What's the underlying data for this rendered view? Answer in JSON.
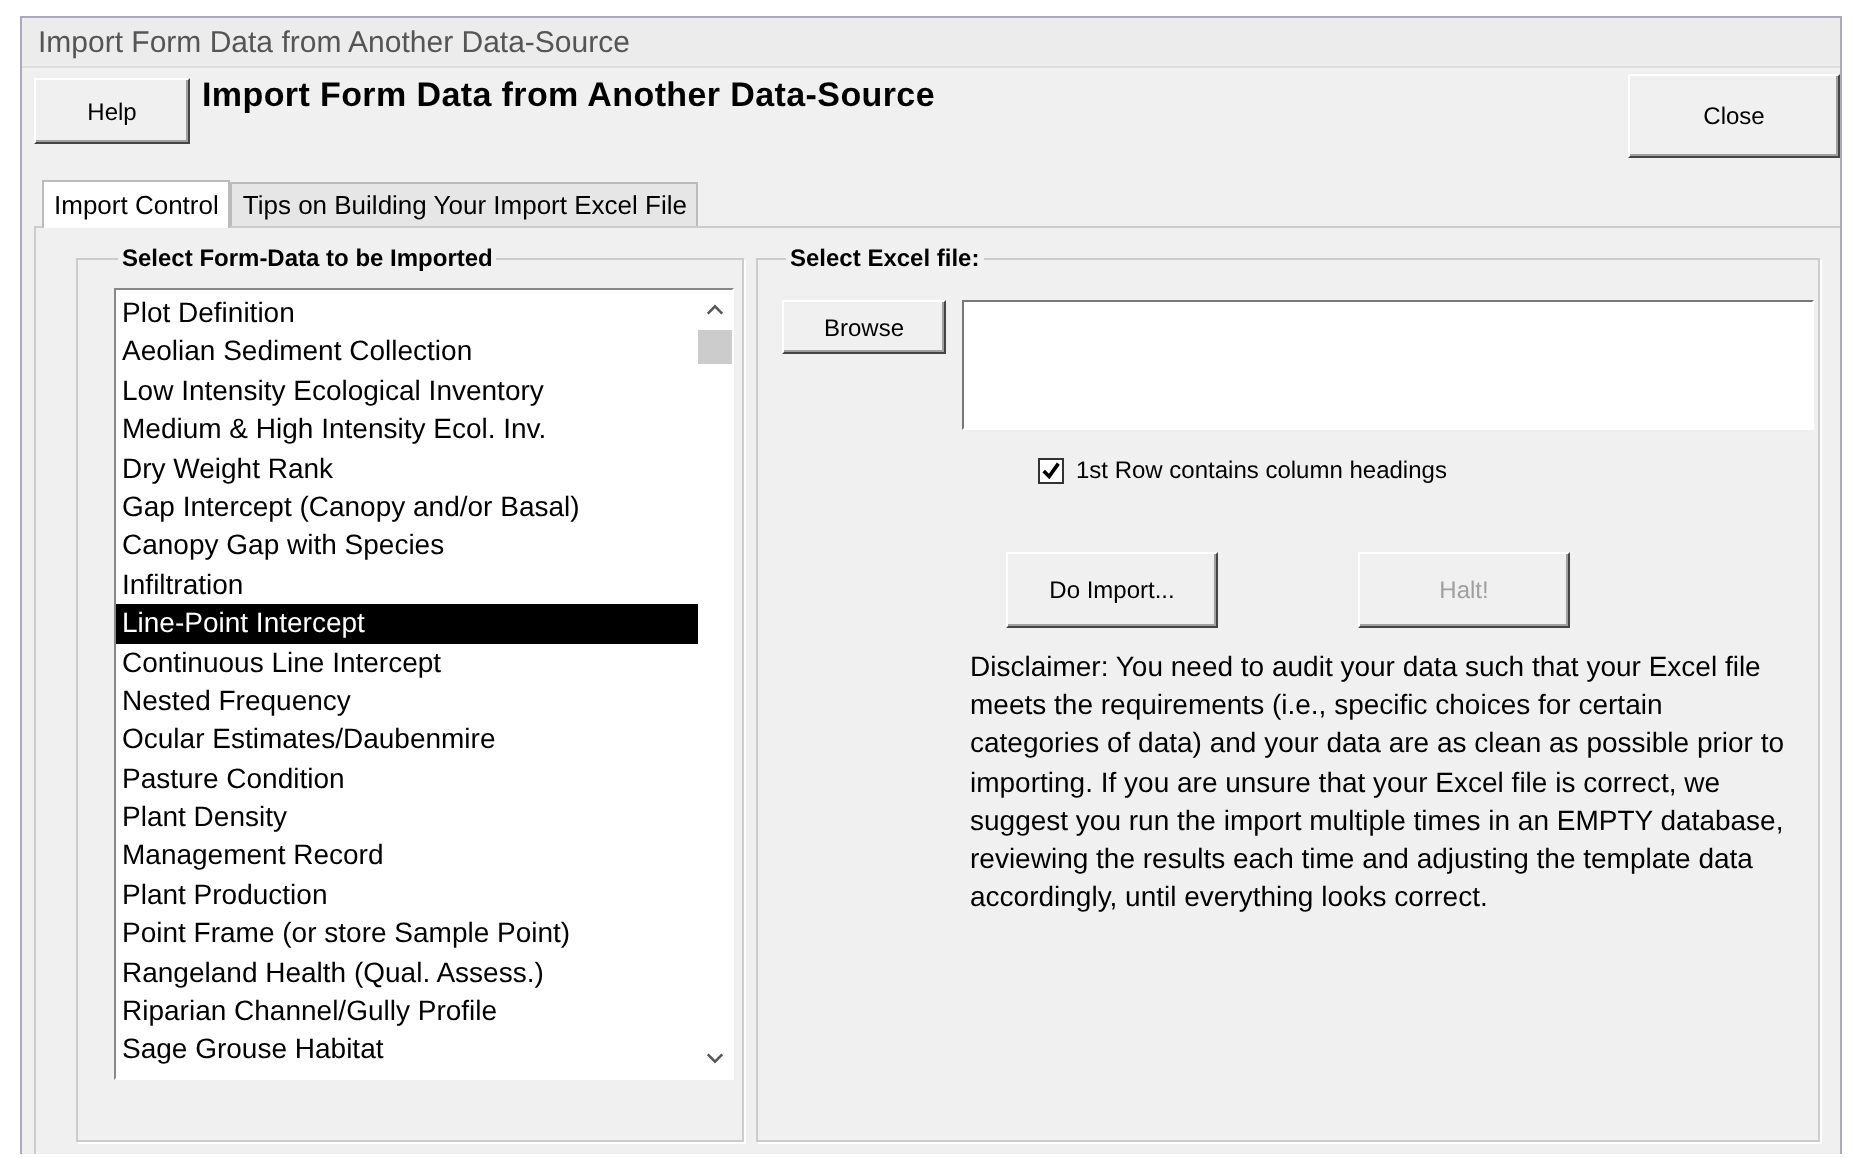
{
  "window": {
    "title": "Import Form Data from Another Data-Source"
  },
  "header": {
    "help_button": "Help",
    "title": "Import Form Data from Another Data-Source",
    "close_button": "Close"
  },
  "tabs": [
    {
      "label": "Import Control",
      "selected": true
    },
    {
      "label": "Tips on Building Your Import Excel File",
      "selected": false
    }
  ],
  "forms_group": {
    "legend": "Select Form-Data to be Imported",
    "items": [
      {
        "label": "Plot Definition",
        "selected": false
      },
      {
        "label": "Aeolian Sediment Collection",
        "selected": false
      },
      {
        "label": "Low Intensity Ecological Inventory",
        "selected": false
      },
      {
        "label": "Medium & High Intensity Ecol. Inv.",
        "selected": false
      },
      {
        "label": "Dry Weight Rank",
        "selected": false
      },
      {
        "label": "Gap Intercept (Canopy and/or Basal)",
        "selected": false
      },
      {
        "label": "Canopy Gap with Species",
        "selected": false
      },
      {
        "label": "Infiltration",
        "selected": false
      },
      {
        "label": "Line-Point Intercept",
        "selected": true
      },
      {
        "label": "Continuous Line Intercept",
        "selected": false
      },
      {
        "label": "Nested Frequency",
        "selected": false
      },
      {
        "label": "Ocular Estimates/Daubenmire",
        "selected": false
      },
      {
        "label": "Pasture Condition",
        "selected": false
      },
      {
        "label": "Plant Density",
        "selected": false
      },
      {
        "label": "Management Record",
        "selected": false
      },
      {
        "label": "Plant Production",
        "selected": false
      },
      {
        "label": "Point Frame (or store Sample Point)",
        "selected": false
      },
      {
        "label": "Rangeland Health (Qual. Assess.)",
        "selected": false
      },
      {
        "label": "Riparian Channel/Gully Profile",
        "selected": false
      },
      {
        "label": "Sage Grouse Habitat",
        "selected": false
      }
    ]
  },
  "file_group": {
    "legend": "Select Excel file:",
    "browse_button": "Browse",
    "header_row_checkbox": {
      "label": "1st Row contains column headings",
      "checked": true
    },
    "buttons": [
      {
        "label": "Do Import...",
        "disabled": false
      },
      {
        "label": "Halt!",
        "disabled": true
      }
    ],
    "disclaimer": "Disclaimer:  You need to audit your data such that your Excel file meets the requirements (i.e., specific choices for certain categories of data) and your data are as clean as possible prior to importing.  If you are unsure that your Excel file is correct, we suggest you run the import multiple times in an EMPTY database, reviewing the results each time and adjusting the template data accordingly, until everything looks correct."
  }
}
